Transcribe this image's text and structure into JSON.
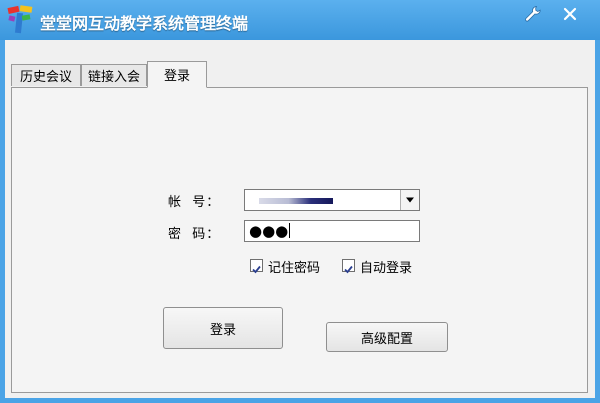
{
  "window": {
    "title": "堂堂网互动教学系统管理终端",
    "accent_color": "#4aa3e6",
    "icons": [
      "app-logo-icon",
      "wrench-icon",
      "close-icon"
    ]
  },
  "tabs": [
    {
      "label": "历史会议",
      "selected": false
    },
    {
      "label": "链接入会",
      "selected": false
    },
    {
      "label": "登录",
      "selected": true
    }
  ],
  "form": {
    "account_label": "帐  号：",
    "password_label": "密  码：",
    "password_value": "●●●",
    "remember_password": {
      "label": "记住密码",
      "checked": true
    },
    "auto_login": {
      "label": "自动登录",
      "checked": true
    }
  },
  "buttons": {
    "login": "登录",
    "advanced_config": "高级配置"
  }
}
